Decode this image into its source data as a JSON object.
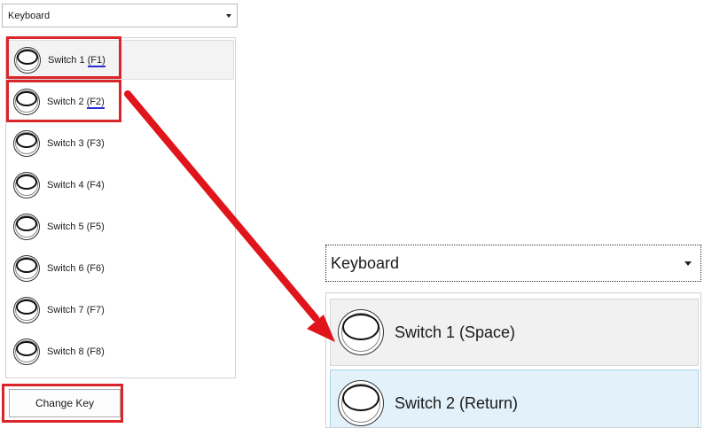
{
  "device_dropdown": {
    "value": "Keyboard"
  },
  "switches": [
    {
      "label": "Switch 1",
      "key": "(F1)"
    },
    {
      "label": "Switch 2",
      "key": "(F2)"
    },
    {
      "label": "Switch 3",
      "key": "(F3)"
    },
    {
      "label": "Switch 4",
      "key": "(F4)"
    },
    {
      "label": "Switch 5",
      "key": "(F5)"
    },
    {
      "label": "Switch 6",
      "key": "(F6)"
    },
    {
      "label": "Switch 7",
      "key": "(F7)"
    },
    {
      "label": "Switch 8",
      "key": "(F8)"
    }
  ],
  "change_key_button": {
    "label": "Change Key"
  },
  "zoom_view": {
    "dropdown_value": "Keyboard",
    "items": [
      {
        "label": "Switch 1 (Space)"
      },
      {
        "label": "Switch 2 (Return)"
      }
    ]
  },
  "colors": {
    "highlight": "#d9262b",
    "arrow": "#e0141b",
    "key_underline": "#2b2bd6",
    "focus_fill": "#e3f1fa"
  }
}
